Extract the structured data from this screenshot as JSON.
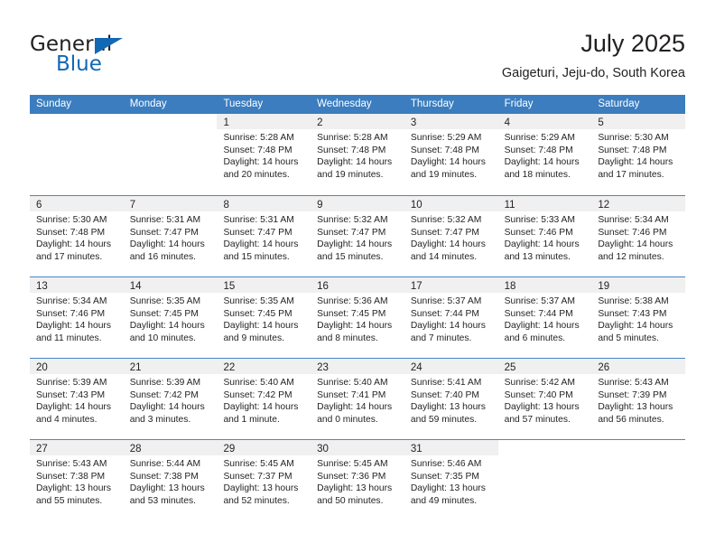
{
  "brand": {
    "name_part1": "General",
    "name_part2": "Blue",
    "accent_color": "#1268b3",
    "triangle_icon": "brand-triangle-icon"
  },
  "header": {
    "title": "July 2025",
    "subtitle": "Gaigeturi, Jeju-do, South Korea"
  },
  "calendar": {
    "header_bg": "#3b7dbf",
    "row_divider_color": "#4a86c5",
    "day_header_bg": "#f0f0f0",
    "weekdays": [
      "Sunday",
      "Monday",
      "Tuesday",
      "Wednesday",
      "Thursday",
      "Friday",
      "Saturday"
    ],
    "weeks": [
      [
        {
          "day": "",
          "empty": true,
          "lines": []
        },
        {
          "day": "",
          "empty": true,
          "lines": []
        },
        {
          "day": "1",
          "lines": [
            "Sunrise: 5:28 AM",
            "Sunset: 7:48 PM",
            "Daylight: 14 hours",
            "and 20 minutes."
          ]
        },
        {
          "day": "2",
          "lines": [
            "Sunrise: 5:28 AM",
            "Sunset: 7:48 PM",
            "Daylight: 14 hours",
            "and 19 minutes."
          ]
        },
        {
          "day": "3",
          "lines": [
            "Sunrise: 5:29 AM",
            "Sunset: 7:48 PM",
            "Daylight: 14 hours",
            "and 19 minutes."
          ]
        },
        {
          "day": "4",
          "lines": [
            "Sunrise: 5:29 AM",
            "Sunset: 7:48 PM",
            "Daylight: 14 hours",
            "and 18 minutes."
          ]
        },
        {
          "day": "5",
          "lines": [
            "Sunrise: 5:30 AM",
            "Sunset: 7:48 PM",
            "Daylight: 14 hours",
            "and 17 minutes."
          ]
        }
      ],
      [
        {
          "day": "6",
          "lines": [
            "Sunrise: 5:30 AM",
            "Sunset: 7:48 PM",
            "Daylight: 14 hours",
            "and 17 minutes."
          ]
        },
        {
          "day": "7",
          "lines": [
            "Sunrise: 5:31 AM",
            "Sunset: 7:47 PM",
            "Daylight: 14 hours",
            "and 16 minutes."
          ]
        },
        {
          "day": "8",
          "lines": [
            "Sunrise: 5:31 AM",
            "Sunset: 7:47 PM",
            "Daylight: 14 hours",
            "and 15 minutes."
          ]
        },
        {
          "day": "9",
          "lines": [
            "Sunrise: 5:32 AM",
            "Sunset: 7:47 PM",
            "Daylight: 14 hours",
            "and 15 minutes."
          ]
        },
        {
          "day": "10",
          "lines": [
            "Sunrise: 5:32 AM",
            "Sunset: 7:47 PM",
            "Daylight: 14 hours",
            "and 14 minutes."
          ]
        },
        {
          "day": "11",
          "lines": [
            "Sunrise: 5:33 AM",
            "Sunset: 7:46 PM",
            "Daylight: 14 hours",
            "and 13 minutes."
          ]
        },
        {
          "day": "12",
          "lines": [
            "Sunrise: 5:34 AM",
            "Sunset: 7:46 PM",
            "Daylight: 14 hours",
            "and 12 minutes."
          ]
        }
      ],
      [
        {
          "day": "13",
          "lines": [
            "Sunrise: 5:34 AM",
            "Sunset: 7:46 PM",
            "Daylight: 14 hours",
            "and 11 minutes."
          ]
        },
        {
          "day": "14",
          "lines": [
            "Sunrise: 5:35 AM",
            "Sunset: 7:45 PM",
            "Daylight: 14 hours",
            "and 10 minutes."
          ]
        },
        {
          "day": "15",
          "lines": [
            "Sunrise: 5:35 AM",
            "Sunset: 7:45 PM",
            "Daylight: 14 hours",
            "and 9 minutes."
          ]
        },
        {
          "day": "16",
          "lines": [
            "Sunrise: 5:36 AM",
            "Sunset: 7:45 PM",
            "Daylight: 14 hours",
            "and 8 minutes."
          ]
        },
        {
          "day": "17",
          "lines": [
            "Sunrise: 5:37 AM",
            "Sunset: 7:44 PM",
            "Daylight: 14 hours",
            "and 7 minutes."
          ]
        },
        {
          "day": "18",
          "lines": [
            "Sunrise: 5:37 AM",
            "Sunset: 7:44 PM",
            "Daylight: 14 hours",
            "and 6 minutes."
          ]
        },
        {
          "day": "19",
          "lines": [
            "Sunrise: 5:38 AM",
            "Sunset: 7:43 PM",
            "Daylight: 14 hours",
            "and 5 minutes."
          ]
        }
      ],
      [
        {
          "day": "20",
          "lines": [
            "Sunrise: 5:39 AM",
            "Sunset: 7:43 PM",
            "Daylight: 14 hours",
            "and 4 minutes."
          ]
        },
        {
          "day": "21",
          "lines": [
            "Sunrise: 5:39 AM",
            "Sunset: 7:42 PM",
            "Daylight: 14 hours",
            "and 3 minutes."
          ]
        },
        {
          "day": "22",
          "lines": [
            "Sunrise: 5:40 AM",
            "Sunset: 7:42 PM",
            "Daylight: 14 hours",
            "and 1 minute."
          ]
        },
        {
          "day": "23",
          "lines": [
            "Sunrise: 5:40 AM",
            "Sunset: 7:41 PM",
            "Daylight: 14 hours",
            "and 0 minutes."
          ]
        },
        {
          "day": "24",
          "lines": [
            "Sunrise: 5:41 AM",
            "Sunset: 7:40 PM",
            "Daylight: 13 hours",
            "and 59 minutes."
          ]
        },
        {
          "day": "25",
          "lines": [
            "Sunrise: 5:42 AM",
            "Sunset: 7:40 PM",
            "Daylight: 13 hours",
            "and 57 minutes."
          ]
        },
        {
          "day": "26",
          "lines": [
            "Sunrise: 5:43 AM",
            "Sunset: 7:39 PM",
            "Daylight: 13 hours",
            "and 56 minutes."
          ]
        }
      ],
      [
        {
          "day": "27",
          "lines": [
            "Sunrise: 5:43 AM",
            "Sunset: 7:38 PM",
            "Daylight: 13 hours",
            "and 55 minutes."
          ]
        },
        {
          "day": "28",
          "lines": [
            "Sunrise: 5:44 AM",
            "Sunset: 7:38 PM",
            "Daylight: 13 hours",
            "and 53 minutes."
          ]
        },
        {
          "day": "29",
          "lines": [
            "Sunrise: 5:45 AM",
            "Sunset: 7:37 PM",
            "Daylight: 13 hours",
            "and 52 minutes."
          ]
        },
        {
          "day": "30",
          "lines": [
            "Sunrise: 5:45 AM",
            "Sunset: 7:36 PM",
            "Daylight: 13 hours",
            "and 50 minutes."
          ]
        },
        {
          "day": "31",
          "lines": [
            "Sunrise: 5:46 AM",
            "Sunset: 7:35 PM",
            "Daylight: 13 hours",
            "and 49 minutes."
          ]
        },
        {
          "day": "",
          "empty": true,
          "lines": []
        },
        {
          "day": "",
          "empty": true,
          "lines": []
        }
      ]
    ]
  }
}
